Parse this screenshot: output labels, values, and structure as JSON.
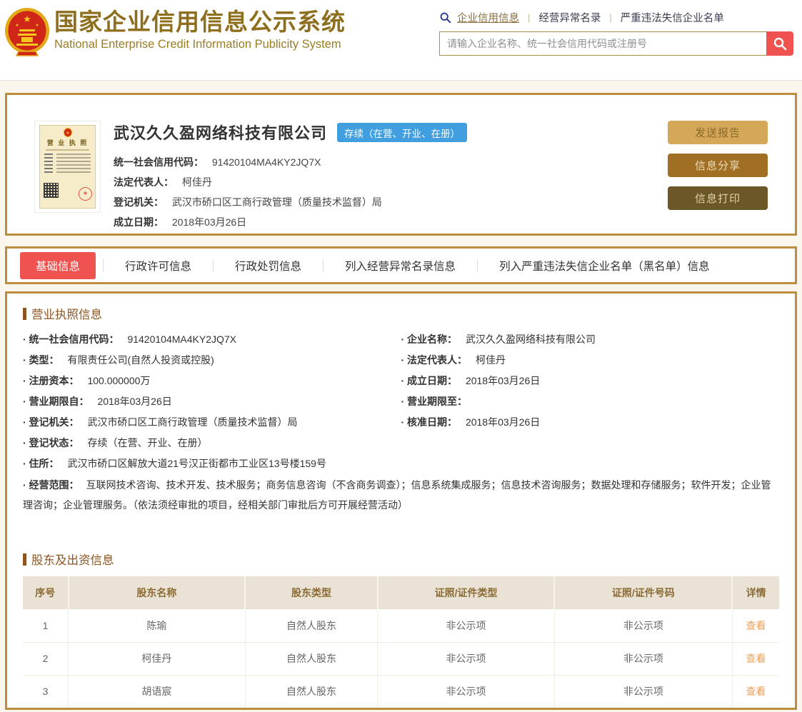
{
  "header": {
    "title": "国家企业信用信息公示系统",
    "subtitle": "National Enterprise Credit Information Publicity System",
    "nav": [
      {
        "label": "企业信用信息"
      },
      {
        "label": "经营异常名录"
      },
      {
        "label": "严重违法失信企业名单"
      }
    ],
    "search": {
      "placeholder": "请输入企业名称、统一社会信用代码或注册号"
    }
  },
  "summary": {
    "license_title": "营 业 执 照",
    "company_name": "武汉久久盈网络科技有限公司",
    "status_badge": "存续（在营、开业、在册）",
    "fields": [
      {
        "label": "统一社会信用代码：",
        "value": "91420104MA4KY2JQ7X"
      },
      {
        "label": "法定代表人：",
        "value": "柯佳丹"
      },
      {
        "label": "登记机关：",
        "value": "武汉市硚口区工商行政管理（质量技术监督）局"
      },
      {
        "label": "成立日期：",
        "value": "2018年03月26日"
      }
    ],
    "buttons": {
      "send": "发送报告",
      "share": "信息分享",
      "print": "信息打印"
    }
  },
  "tabs": [
    {
      "label": "基础信息"
    },
    {
      "label": "行政许可信息"
    },
    {
      "label": "行政处罚信息"
    },
    {
      "label": "列入经营异常名录信息"
    },
    {
      "label": "列入严重违法失信企业名单（黑名单）信息"
    }
  ],
  "license_section": {
    "title": "营业执照信息",
    "left": [
      {
        "label": "· 统一社会信用代码：",
        "value": "91420104MA4KY2JQ7X"
      },
      {
        "label": "· 类型：",
        "value": "有限责任公司(自然人投资或控股)"
      },
      {
        "label": "· 注册资本：",
        "value": "100.000000万"
      },
      {
        "label": "· 营业期限自：",
        "value": "2018年03月26日"
      },
      {
        "label": "· 登记机关：",
        "value": "武汉市硚口区工商行政管理（质量技术监督）局"
      },
      {
        "label": "· 登记状态：",
        "value": "存续（在营、开业、在册）"
      },
      {
        "label": "· 住所：",
        "value": "武汉市硚口区解放大道21号汉正街都市工业区13号楼159号"
      }
    ],
    "right": [
      {
        "label": "· 企业名称：",
        "value": "武汉久久盈网络科技有限公司"
      },
      {
        "label": "· 法定代表人：",
        "value": "柯佳丹"
      },
      {
        "label": "· 成立日期：",
        "value": "2018年03月26日"
      },
      {
        "label": "· 营业期限至：",
        "value": ""
      },
      {
        "label": "· 核准日期：",
        "value": "2018年03月26日"
      }
    ],
    "scope": {
      "label": "· 经营范围：",
      "value": "互联网技术咨询、技术开发、技术服务；商务信息咨询（不含商务调查）；信息系统集成服务；信息技术咨询服务；数据处理和存储服务；软件开发；企业管理咨询；企业管理服务。（依法须经审批的项目，经相关部门审批后方可开展经营活动）"
    }
  },
  "shareholders": {
    "title": "股东及出资信息",
    "headers": [
      "序号",
      "股东名称",
      "股东类型",
      "证照/证件类型",
      "证照/证件号码",
      "详情"
    ],
    "rows": [
      {
        "seq": "1",
        "name": "陈瑜",
        "type": "自然人股东",
        "cert_type": "非公示项",
        "cert_no": "非公示项",
        "detail": "查看"
      },
      {
        "seq": "2",
        "name": "柯佳丹",
        "type": "自然人股东",
        "cert_type": "非公示项",
        "cert_no": "非公示项",
        "detail": "查看"
      },
      {
        "seq": "3",
        "name": "胡语宸",
        "type": "自然人股东",
        "cert_type": "非公示项",
        "cert_no": "非公示项",
        "detail": "查看"
      }
    ]
  },
  "colors": {
    "gold_border": "#bb8d3c",
    "title_gold": "#8e6f1e",
    "active_tab_red": "#f0534f",
    "search_button_red": "#f0534f",
    "status_badge_blue": "#419fdf",
    "button_send_bg": "#d4a759",
    "button_share_bg": "#a06f24",
    "button_print_bg": "#6b5826",
    "section_title_brown": "#8e5420",
    "table_header_bg": "#eae3d5",
    "table_header_text": "#8b6b33",
    "view_link_orange": "#f0a05a"
  }
}
